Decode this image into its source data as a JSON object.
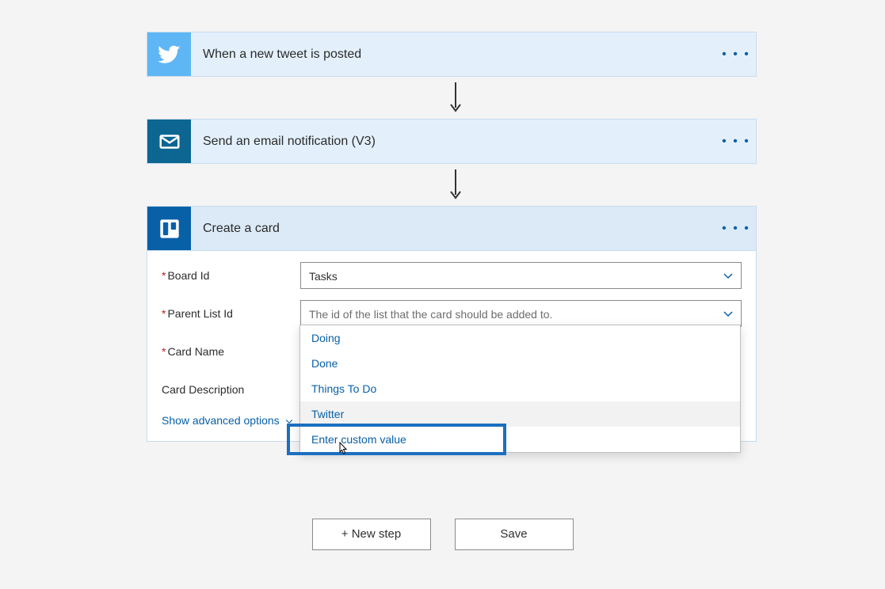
{
  "steps": {
    "trigger": {
      "title": "When a new tweet is posted"
    },
    "email": {
      "title": "Send an email notification (V3)"
    },
    "trello": {
      "title": "Create a card"
    }
  },
  "menu_glyph": "• • •",
  "trello_form": {
    "board": {
      "label": "Board Id",
      "required_mark": "*",
      "value": "Tasks"
    },
    "parent_list": {
      "label": "Parent List Id",
      "required_mark": "*",
      "placeholder": "The id of the list that the card should be added to.",
      "options": [
        "Doing",
        "Done",
        "Things To Do",
        "Twitter",
        "Enter custom value"
      ],
      "highlighted_option": "Twitter"
    },
    "card_name": {
      "label": "Card Name",
      "required_mark": "*"
    },
    "card_desc": {
      "label": "Card Description"
    },
    "advanced_link": "Show advanced options"
  },
  "buttons": {
    "new_step": "+ New step",
    "save": "Save"
  }
}
